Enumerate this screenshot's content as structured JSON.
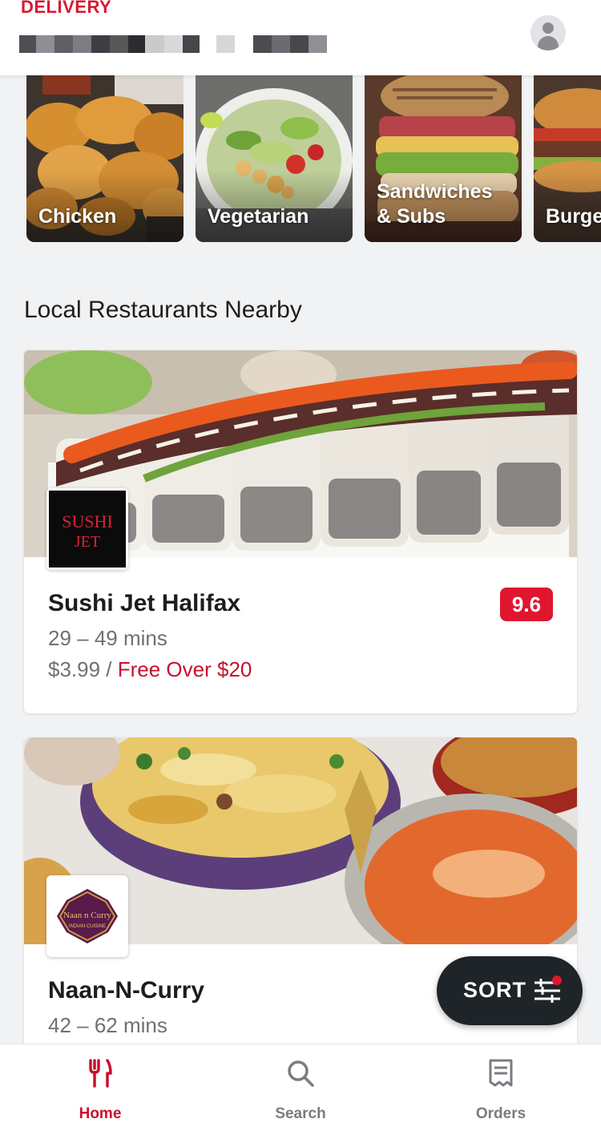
{
  "header": {
    "delivery_label": "DELIVERY",
    "address_redacted": true
  },
  "categories": [
    {
      "label": "Chicken"
    },
    {
      "label": "Vegetarian"
    },
    {
      "label": "Sandwiches\n& Subs"
    },
    {
      "label": "Burge"
    }
  ],
  "section_title": "Local Restaurants Nearby",
  "restaurants": [
    {
      "name": "Sushi Jet Halifax",
      "time": "29 – 49 mins",
      "fee": "$3.99",
      "fee_sep": " / ",
      "free_text": "Free Over $20",
      "rating": "9.6",
      "logo_line1": "SUSHI",
      "logo_line2": "JET"
    },
    {
      "name": "Naan-N-Curry",
      "time": "42 – 62 mins",
      "logo_line1": "Naan n Curry",
      "logo_line2": "INDIAN CUISINE"
    }
  ],
  "sort": {
    "label": "SORT"
  },
  "nav": {
    "home": "Home",
    "search": "Search",
    "orders": "Orders"
  },
  "colors": {
    "brand_red": "#d71a32",
    "rating_bg": "#e0162f",
    "free_text": "#c8102e",
    "sort_bg": "#1f2428"
  }
}
